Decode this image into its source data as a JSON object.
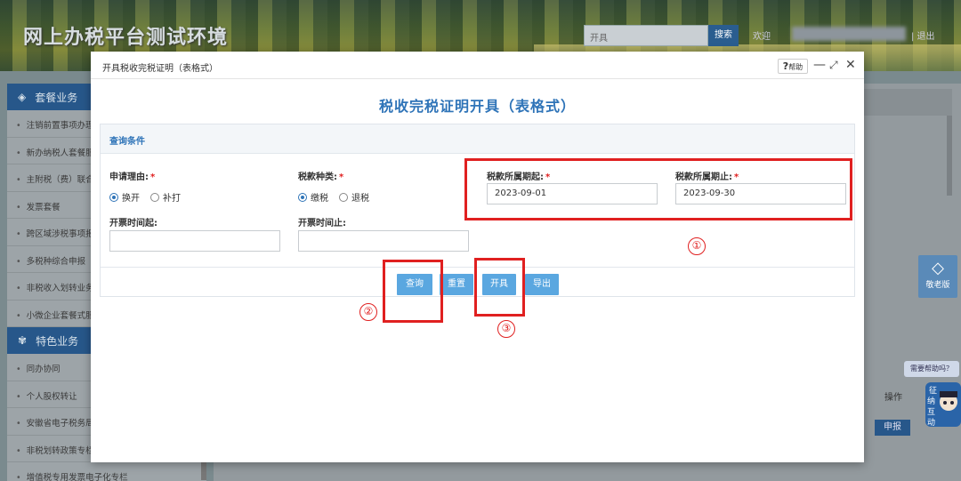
{
  "header": {
    "site_title": "网上办税平台测试环境",
    "search_value": "开具",
    "search_button": "搜索",
    "welcome": "欢迎",
    "exit": "| 退出"
  },
  "sidebar": {
    "group1": "套餐业务",
    "group1_items": [
      "注销前置事项办理",
      "新办纳税人套餐服务",
      "主附税（费）联合申报",
      "发票套餐",
      "跨区域涉税事项报告",
      "多税种综合申报",
      "非税收入划转业务",
      "小微企业套餐式服务"
    ],
    "group2": "特色业务",
    "group2_items": [
      "同办协同",
      "个人股权转让",
      "安徽省电子税务局",
      "非税划转政策专栏",
      "增值税专用发票电子化专栏"
    ]
  },
  "background": {
    "operation_col": "操作",
    "report_button": "申报",
    "elder_mode": "敬老版",
    "help_tip": "需要帮助吗？",
    "mascot_text": [
      "纳",
      "征",
      "互",
      "动"
    ]
  },
  "modal": {
    "window_title": "开具税收完税证明（表格式）",
    "help_label": "帮助",
    "help_icon": "?",
    "form_title": "税收完税证明开具（表格式）",
    "query_section": "查询条件",
    "fields": {
      "reason_label": "申请理由:",
      "reason_options": [
        "换开",
        "补打"
      ],
      "reason_selected": 0,
      "tax_type_label": "税款种类:",
      "tax_type_options": [
        "缴税",
        "退税"
      ],
      "tax_type_selected": 0,
      "period_start_label": "税款所属期起:",
      "period_start_value": "2023-09-01",
      "period_end_label": "税款所属期止:",
      "period_end_value": "2023-09-30",
      "issue_start_label": "开票时间起:",
      "issue_start_value": "",
      "issue_end_label": "开票时间止:",
      "issue_end_value": ""
    },
    "buttons": {
      "query": "查询",
      "reset": "重置",
      "issue": "开具",
      "export": "导出"
    }
  },
  "annotations": [
    "①",
    "②",
    "③"
  ],
  "colors": {
    "accent": "#2f74b8",
    "button": "#5aa7e0",
    "annotation": "#e02020",
    "required": "#e02020"
  }
}
